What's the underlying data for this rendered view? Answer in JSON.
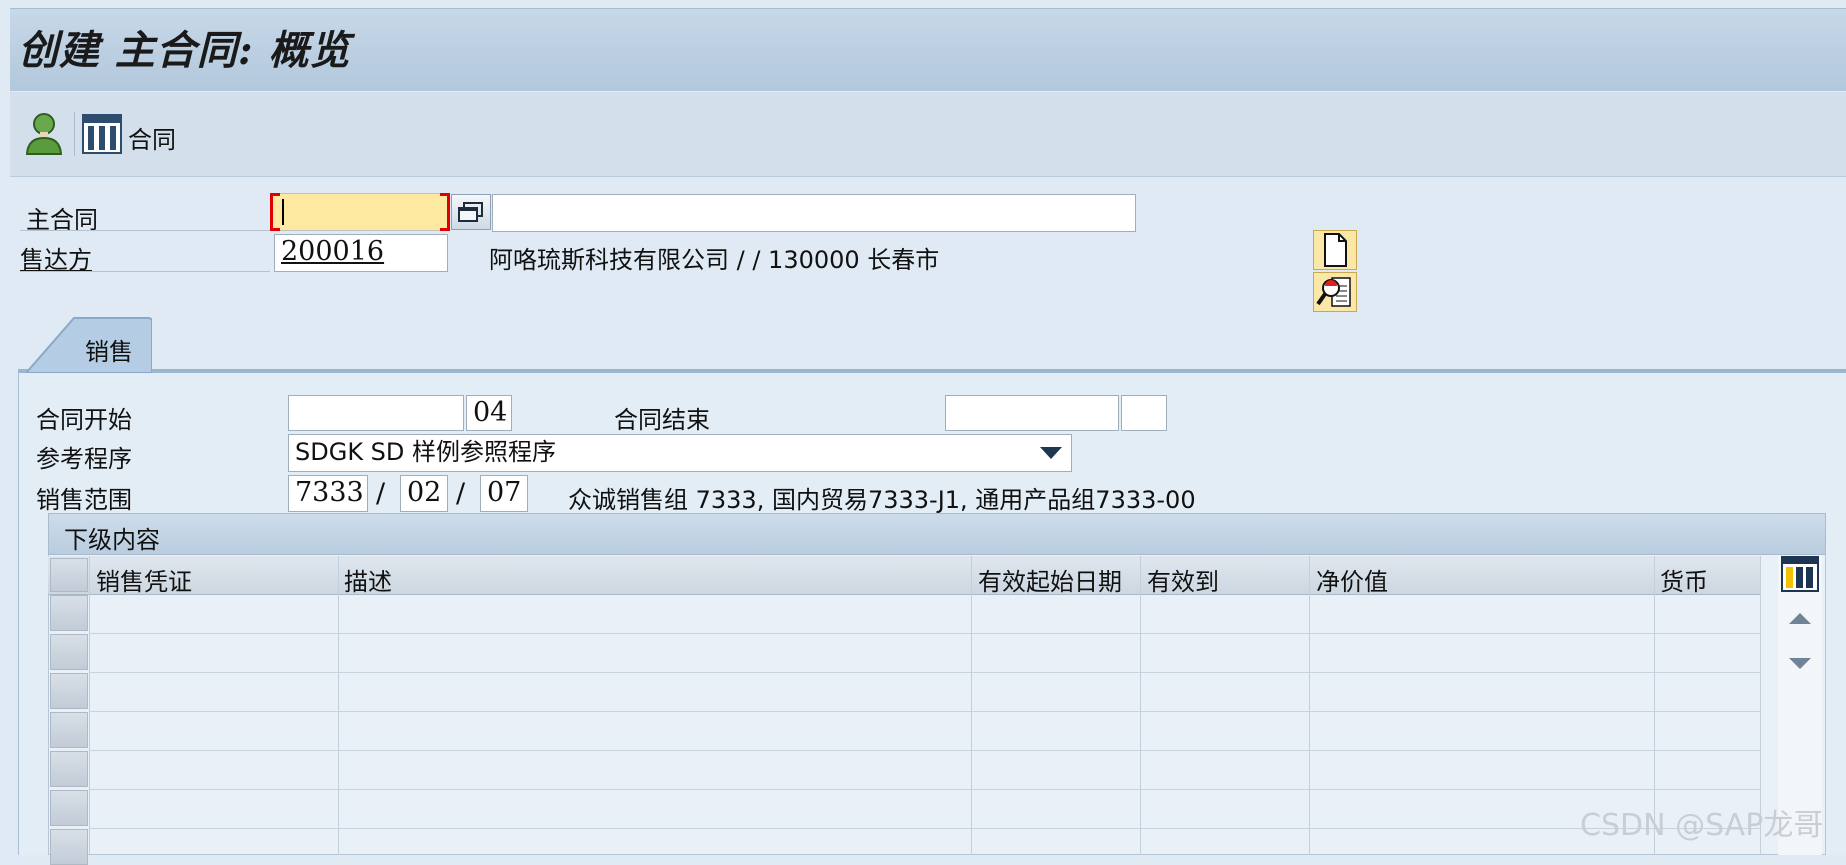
{
  "window": {
    "title": "创建 主合同: 概览"
  },
  "toolbar": {
    "contract_label": "合同",
    "icons": [
      "user-icon",
      "table-layout-icon"
    ]
  },
  "header": {
    "master_contract": {
      "label": "主合同",
      "value": "",
      "description": ""
    },
    "sold_to": {
      "label": "售达方",
      "value": "200016",
      "description": "阿咯琉斯科技有限公司 / / 130000 长春市"
    }
  },
  "tabs": [
    {
      "label": "销售",
      "active": true
    }
  ],
  "sales_tab": {
    "contract_start": {
      "label": "合同开始",
      "date": "",
      "rule": "04"
    },
    "contract_end": {
      "label": "合同结束",
      "date": "",
      "rule": ""
    },
    "reference_procedure": {
      "label": "参考程序",
      "value": "SDGK SD 样例参照程序"
    },
    "sales_area": {
      "label": "销售范围",
      "sales_org": "7333",
      "distribution_channel": "02",
      "division": "07",
      "separator": "/",
      "description": "众诚销售组 7333, 国内贸易7333-J1, 通用产品组7333-00"
    }
  },
  "subordinate_table": {
    "title": "下级内容",
    "columns": [
      "销售凭证",
      "描述",
      "有效起始日期",
      "有效到",
      "净价值",
      "货币"
    ],
    "rows": []
  },
  "watermark": "CSDN @SAP龙哥",
  "colors": {
    "title_bg": "#b8cde0",
    "required_field": "#fde9a0",
    "error_marker": "#e00000"
  }
}
